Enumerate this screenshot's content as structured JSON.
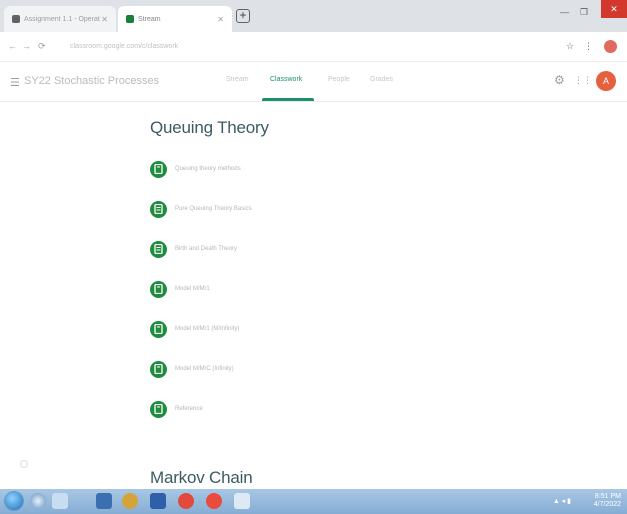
{
  "browser": {
    "tabs": [
      {
        "title": "Assignment 1.1 - Operat"
      },
      {
        "title": "Stream"
      }
    ],
    "new_tab": "+",
    "minimize": "—",
    "maximize": "❐",
    "close": "✕",
    "back": "←",
    "forward": "→",
    "reload": "⟳",
    "address": "classroom.google.com/c/classwork",
    "star_icon": "☆",
    "extension_icon": "⋮"
  },
  "classroom": {
    "menu_icon": "☰",
    "class_name": "SY22 Stochastic Processes",
    "tabs": [
      {
        "label": "Stream"
      },
      {
        "label": "Classwork"
      },
      {
        "label": "People"
      },
      {
        "label": "Grades"
      }
    ],
    "active_tab_index": 1,
    "settings_icon": "⚙",
    "apps_icon": "⋮⋮",
    "avatar_letter": "A"
  },
  "topics": [
    {
      "title": "Queuing Theory",
      "items": [
        {
          "label": "Queuing theory methods"
        },
        {
          "label": "Pure Queuing Theory Basics"
        },
        {
          "label": "Birth and Death Theory"
        },
        {
          "label": "Model M/M/1"
        },
        {
          "label": "Model M/M/1 (M/Infinity)"
        },
        {
          "label": "Model M/M/C (Infinity)"
        },
        {
          "label": "Reference"
        }
      ]
    },
    {
      "title": "Markov Chain",
      "items": []
    }
  ],
  "taskbar": {
    "time": "8:51 PM",
    "date": "4/7/2022",
    "tray": "▲ ◂ ▮"
  },
  "colors": {
    "accent_green": "#1e8e6e",
    "item_icon_green": "#1e8e3e",
    "topic_title": "#3c5b63"
  }
}
